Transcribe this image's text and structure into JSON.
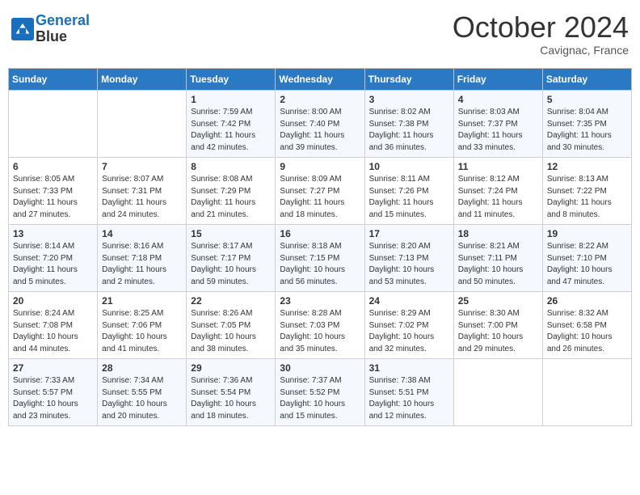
{
  "header": {
    "logo_line1": "General",
    "logo_line2": "Blue",
    "month": "October 2024",
    "location": "Cavignac, France"
  },
  "days_of_week": [
    "Sunday",
    "Monday",
    "Tuesday",
    "Wednesday",
    "Thursday",
    "Friday",
    "Saturday"
  ],
  "weeks": [
    [
      {
        "day": "",
        "info": ""
      },
      {
        "day": "",
        "info": ""
      },
      {
        "day": "1",
        "info": "Sunrise: 7:59 AM\nSunset: 7:42 PM\nDaylight: 11 hours and 42 minutes."
      },
      {
        "day": "2",
        "info": "Sunrise: 8:00 AM\nSunset: 7:40 PM\nDaylight: 11 hours and 39 minutes."
      },
      {
        "day": "3",
        "info": "Sunrise: 8:02 AM\nSunset: 7:38 PM\nDaylight: 11 hours and 36 minutes."
      },
      {
        "day": "4",
        "info": "Sunrise: 8:03 AM\nSunset: 7:37 PM\nDaylight: 11 hours and 33 minutes."
      },
      {
        "day": "5",
        "info": "Sunrise: 8:04 AM\nSunset: 7:35 PM\nDaylight: 11 hours and 30 minutes."
      }
    ],
    [
      {
        "day": "6",
        "info": "Sunrise: 8:05 AM\nSunset: 7:33 PM\nDaylight: 11 hours and 27 minutes."
      },
      {
        "day": "7",
        "info": "Sunrise: 8:07 AM\nSunset: 7:31 PM\nDaylight: 11 hours and 24 minutes."
      },
      {
        "day": "8",
        "info": "Sunrise: 8:08 AM\nSunset: 7:29 PM\nDaylight: 11 hours and 21 minutes."
      },
      {
        "day": "9",
        "info": "Sunrise: 8:09 AM\nSunset: 7:27 PM\nDaylight: 11 hours and 18 minutes."
      },
      {
        "day": "10",
        "info": "Sunrise: 8:11 AM\nSunset: 7:26 PM\nDaylight: 11 hours and 15 minutes."
      },
      {
        "day": "11",
        "info": "Sunrise: 8:12 AM\nSunset: 7:24 PM\nDaylight: 11 hours and 11 minutes."
      },
      {
        "day": "12",
        "info": "Sunrise: 8:13 AM\nSunset: 7:22 PM\nDaylight: 11 hours and 8 minutes."
      }
    ],
    [
      {
        "day": "13",
        "info": "Sunrise: 8:14 AM\nSunset: 7:20 PM\nDaylight: 11 hours and 5 minutes."
      },
      {
        "day": "14",
        "info": "Sunrise: 8:16 AM\nSunset: 7:18 PM\nDaylight: 11 hours and 2 minutes."
      },
      {
        "day": "15",
        "info": "Sunrise: 8:17 AM\nSunset: 7:17 PM\nDaylight: 10 hours and 59 minutes."
      },
      {
        "day": "16",
        "info": "Sunrise: 8:18 AM\nSunset: 7:15 PM\nDaylight: 10 hours and 56 minutes."
      },
      {
        "day": "17",
        "info": "Sunrise: 8:20 AM\nSunset: 7:13 PM\nDaylight: 10 hours and 53 minutes."
      },
      {
        "day": "18",
        "info": "Sunrise: 8:21 AM\nSunset: 7:11 PM\nDaylight: 10 hours and 50 minutes."
      },
      {
        "day": "19",
        "info": "Sunrise: 8:22 AM\nSunset: 7:10 PM\nDaylight: 10 hours and 47 minutes."
      }
    ],
    [
      {
        "day": "20",
        "info": "Sunrise: 8:24 AM\nSunset: 7:08 PM\nDaylight: 10 hours and 44 minutes."
      },
      {
        "day": "21",
        "info": "Sunrise: 8:25 AM\nSunset: 7:06 PM\nDaylight: 10 hours and 41 minutes."
      },
      {
        "day": "22",
        "info": "Sunrise: 8:26 AM\nSunset: 7:05 PM\nDaylight: 10 hours and 38 minutes."
      },
      {
        "day": "23",
        "info": "Sunrise: 8:28 AM\nSunset: 7:03 PM\nDaylight: 10 hours and 35 minutes."
      },
      {
        "day": "24",
        "info": "Sunrise: 8:29 AM\nSunset: 7:02 PM\nDaylight: 10 hours and 32 minutes."
      },
      {
        "day": "25",
        "info": "Sunrise: 8:30 AM\nSunset: 7:00 PM\nDaylight: 10 hours and 29 minutes."
      },
      {
        "day": "26",
        "info": "Sunrise: 8:32 AM\nSunset: 6:58 PM\nDaylight: 10 hours and 26 minutes."
      }
    ],
    [
      {
        "day": "27",
        "info": "Sunrise: 7:33 AM\nSunset: 5:57 PM\nDaylight: 10 hours and 23 minutes."
      },
      {
        "day": "28",
        "info": "Sunrise: 7:34 AM\nSunset: 5:55 PM\nDaylight: 10 hours and 20 minutes."
      },
      {
        "day": "29",
        "info": "Sunrise: 7:36 AM\nSunset: 5:54 PM\nDaylight: 10 hours and 18 minutes."
      },
      {
        "day": "30",
        "info": "Sunrise: 7:37 AM\nSunset: 5:52 PM\nDaylight: 10 hours and 15 minutes."
      },
      {
        "day": "31",
        "info": "Sunrise: 7:38 AM\nSunset: 5:51 PM\nDaylight: 10 hours and 12 minutes."
      },
      {
        "day": "",
        "info": ""
      },
      {
        "day": "",
        "info": ""
      }
    ]
  ]
}
